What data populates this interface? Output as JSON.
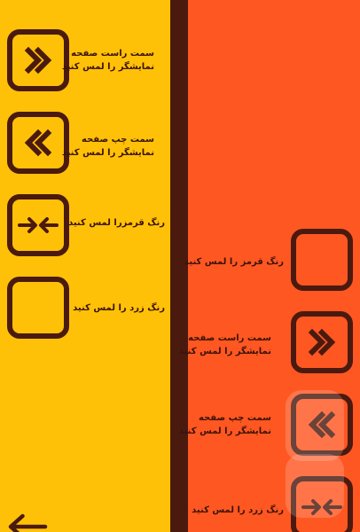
{
  "colors": {
    "left_bg": "#FFC107",
    "right_bg": "#FF5722",
    "divider": "#4A1A0F",
    "outline": "#4A1A0F",
    "text": "#3A1309"
  },
  "left_panel": {
    "items": [
      {
        "icon": "double-chevron-right-icon",
        "line1": "سمت راست صفحه",
        "line2": "نمایشگر را لمس کنید"
      },
      {
        "icon": "double-chevron-left-icon",
        "line1": "سمت چپ صفحه",
        "line2": "نمایشگر را لمس کنید"
      },
      {
        "icon": "arrows-inward-icon",
        "line1": "رنگ قرمزرا لمس کنید",
        "line2": ""
      },
      {
        "icon": "empty-square-icon",
        "line1": "رنگ زرد را لمس کنید",
        "line2": ""
      }
    ],
    "corner_icon": "back-arrow-icon"
  },
  "right_panel": {
    "items": [
      {
        "icon": "empty-square-icon",
        "line1": "رنگ قرمز را لمس کنید",
        "line2": ""
      },
      {
        "icon": "double-chevron-right-icon",
        "line1": "سمت راست صفحه",
        "line2": "نمایشگر را لمس کنید"
      },
      {
        "icon": "double-chevron-left-icon",
        "line1": "سمت چپ صفحه",
        "line2": "نمایشگر را لمس کنید"
      },
      {
        "icon": "arrows-inward-icon",
        "line1": "رنگ زرد را لمس کنید",
        "line2": ""
      }
    ],
    "watermark_icon": "bazaar-watermark-icon"
  }
}
